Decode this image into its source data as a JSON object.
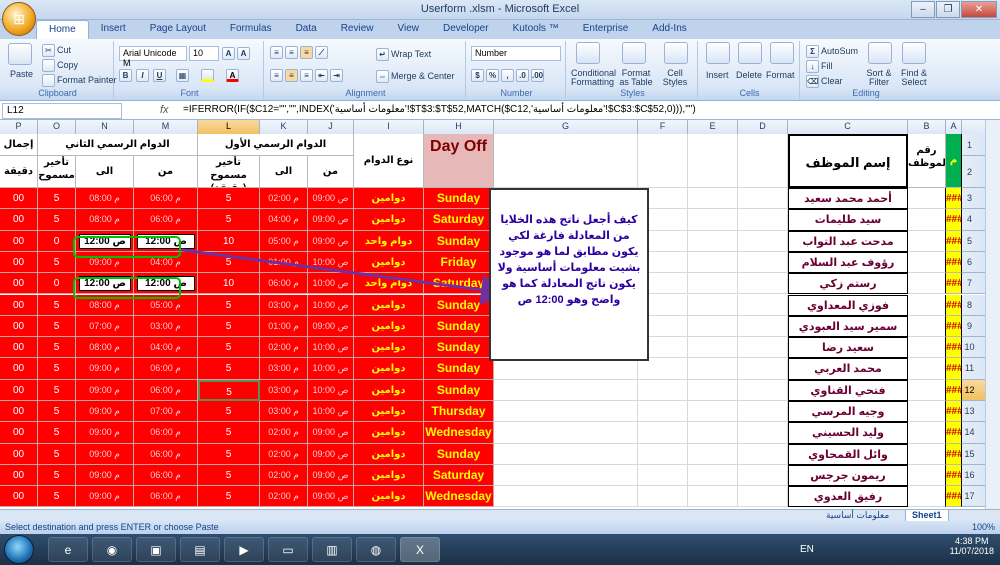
{
  "window": {
    "title": "Userform .xlsm - Microsoft Excel"
  },
  "ribbon_tabs": [
    "Home",
    "Insert",
    "Page Layout",
    "Formulas",
    "Data",
    "Review",
    "View",
    "Developer",
    "Kutools ™",
    "Enterprise",
    "Add-Ins"
  ],
  "ribbon": {
    "clipboard": {
      "label": "Clipboard",
      "paste": "Paste",
      "cut": "Cut",
      "copy": "Copy",
      "format_painter": "Format Painter"
    },
    "font": {
      "label": "Font",
      "font_name": "Arial Unicode M",
      "font_size": "10"
    },
    "alignment": {
      "label": "Alignment",
      "wrap": "Wrap Text",
      "merge": "Merge & Center"
    },
    "number": {
      "label": "Number",
      "format": "Number"
    },
    "styles": {
      "label": "Styles",
      "conditional": "Conditional Formatting",
      "format_table": "Format as Table",
      "cell_styles": "Cell Styles"
    },
    "cells": {
      "label": "Cells",
      "insert": "Insert",
      "delete": "Delete",
      "format": "Format"
    },
    "editing": {
      "label": "Editing",
      "autosum": "AutoSum",
      "fill": "Fill",
      "clear": "Clear",
      "sort": "Sort & Filter",
      "find": "Find & Select"
    }
  },
  "formula_bar": {
    "name_box": "L12",
    "fx": "fx",
    "formula": "=IFERROR(IF($C12=\"\",\"\",INDEX('معلومات أساسية'!$T$3:$T$52,MATCH($C12,'معلومات أساسية'!$C$3:$C$52,0))),\"\")"
  },
  "columns": [
    "P",
    "O",
    "N",
    "M",
    "L",
    "K",
    "J",
    "I",
    "H",
    "G",
    "F",
    "E",
    "D",
    "C",
    "B",
    "A"
  ],
  "row_numbers": [
    "1",
    "2",
    "3",
    "4",
    "5",
    "6",
    "7",
    "8",
    "9",
    "10",
    "11",
    "12",
    "13",
    "14",
    "15",
    "16",
    "17"
  ],
  "headers": {
    "total_cut": "إجمال",
    "second_shift": "الدوام الرسمي الثاني",
    "first_shift": "الدوام الرسمي الأول",
    "allowed_delay2": "تأخير مسموح",
    "to": "الى",
    "from": "من",
    "allowed_delay1": "تأخير مسموح (دقيقة)",
    "shift_type": "نوع الدوام",
    "day_off": "Day Off",
    "employee_name": "إسم الموظف",
    "employee_no": "رقم الموظف",
    "m": "م",
    "minute": "دقيقة"
  },
  "rows": [
    {
      "p": "00",
      "o": "5",
      "n": "08:00 م",
      "m": "06:00 م",
      "l": "5",
      "k": "02:00 م",
      "j": "09:00 ص",
      "i": "دوامين",
      "h": "Sunday",
      "c": "أحمد محمد سعيد",
      "a": "###"
    },
    {
      "p": "00",
      "o": "5",
      "n": "08:00 م",
      "m": "06:00 م",
      "l": "5",
      "k": "04:00 م",
      "j": "09:00 ص",
      "i": "دوامين",
      "h": "Saturday",
      "c": "سيد طليمات",
      "a": "###"
    },
    {
      "p": "00",
      "o": "0",
      "n": "12:00 ص",
      "m": "12:00 ص",
      "l": "10",
      "k": "05:00 م",
      "j": "09:00 ص",
      "i": "دوام واحد",
      "h": "Sunday",
      "c": "مدحت عبد التواب",
      "a": "###"
    },
    {
      "p": "00",
      "o": "5",
      "n": "09:00 م",
      "m": "04:00 م",
      "l": "5",
      "k": "01:00 م",
      "j": "10:00 ص",
      "i": "دوامين",
      "h": "Friday",
      "c": "رؤوف عبد السلام",
      "a": "###"
    },
    {
      "p": "00",
      "o": "0",
      "n": "12:00 ص",
      "m": "12:00 ص",
      "l": "10",
      "k": "06:00 م",
      "j": "10:00 ص",
      "i": "دوام واحد",
      "h": "Saturday",
      "c": "رستم زكي",
      "a": "###"
    },
    {
      "p": "00",
      "o": "5",
      "n": "08:00 م",
      "m": "05:00 م",
      "l": "5",
      "k": "03:00 م",
      "j": "10:00 ص",
      "i": "دوامين",
      "h": "Sunday",
      "c": "فوزي المعداوي",
      "a": "###"
    },
    {
      "p": "00",
      "o": "5",
      "n": "07:00 م",
      "m": "03:00 م",
      "l": "5",
      "k": "01:00 م",
      "j": "09:00 ص",
      "i": "دوامين",
      "h": "Sunday",
      "c": "سمير سيد العبودي",
      "a": "###"
    },
    {
      "p": "00",
      "o": "5",
      "n": "08:00 م",
      "m": "04:00 م",
      "l": "5",
      "k": "02:00 م",
      "j": "10:00 ص",
      "i": "دوامين",
      "h": "Sunday",
      "c": "سعيد رضا",
      "a": "###"
    },
    {
      "p": "00",
      "o": "5",
      "n": "09:00 م",
      "m": "06:00 م",
      "l": "5",
      "k": "03:00 م",
      "j": "10:00 ص",
      "i": "دوامين",
      "h": "Sunday",
      "c": "محمد العربي",
      "a": "###"
    },
    {
      "p": "00",
      "o": "5",
      "n": "09:00 م",
      "m": "06:00 م",
      "l": "5",
      "k": "03:00 م",
      "j": "10:00 ص",
      "i": "دوامين",
      "h": "Sunday",
      "c": "فتحي القناوي",
      "a": "###"
    },
    {
      "p": "00",
      "o": "5",
      "n": "09:00 م",
      "m": "07:00 م",
      "l": "5",
      "k": "03:00 م",
      "j": "10:00 ص",
      "i": "دوامين",
      "h": "Thursday",
      "c": "وجيه المرسي",
      "a": "###"
    },
    {
      "p": "00",
      "o": "5",
      "n": "09:00 م",
      "m": "06:00 م",
      "l": "5",
      "k": "02:00 م",
      "j": "09:00 ص",
      "i": "دوامين",
      "h": "Wednesday",
      "c": "وليد الحسيني",
      "a": "###"
    },
    {
      "p": "00",
      "o": "5",
      "n": "09:00 م",
      "m": "06:00 م",
      "l": "5",
      "k": "02:00 م",
      "j": "09:00 ص",
      "i": "دوامين",
      "h": "Sunday",
      "c": "وائل القمحاوي",
      "a": "###"
    },
    {
      "p": "00",
      "o": "5",
      "n": "09:00 م",
      "m": "06:00 م",
      "l": "5",
      "k": "02:00 م",
      "j": "09:00 ص",
      "i": "دوامين",
      "h": "Saturday",
      "c": "ريمون جرجس",
      "a": "###"
    },
    {
      "p": "00",
      "o": "5",
      "n": "09:00 م",
      "m": "06:00 م",
      "l": "5",
      "k": "02:00 م",
      "j": "09:00 ص",
      "i": "دوامين",
      "h": "Wednesday",
      "c": "رفيق العدوي",
      "a": "###"
    }
  ],
  "callout": {
    "text": "كيف أجعل ناتج هذه الخلايا من المعادلة فارغة لكي يكون مطابق لما هو موجود بشيت معلومات أساسية ولا يكون ناتج المعادلة كما هو واضح وهو 12:00 ص"
  },
  "sheet_tabs": [
    "معلومات أساسية",
    "Sheet1"
  ],
  "status": {
    "text": "Select destination and press ENTER or choose Paste",
    "zoom": "100%"
  },
  "taskbar": {
    "lang": "EN",
    "time": "4:38 PM",
    "date": "11/07/2018"
  }
}
